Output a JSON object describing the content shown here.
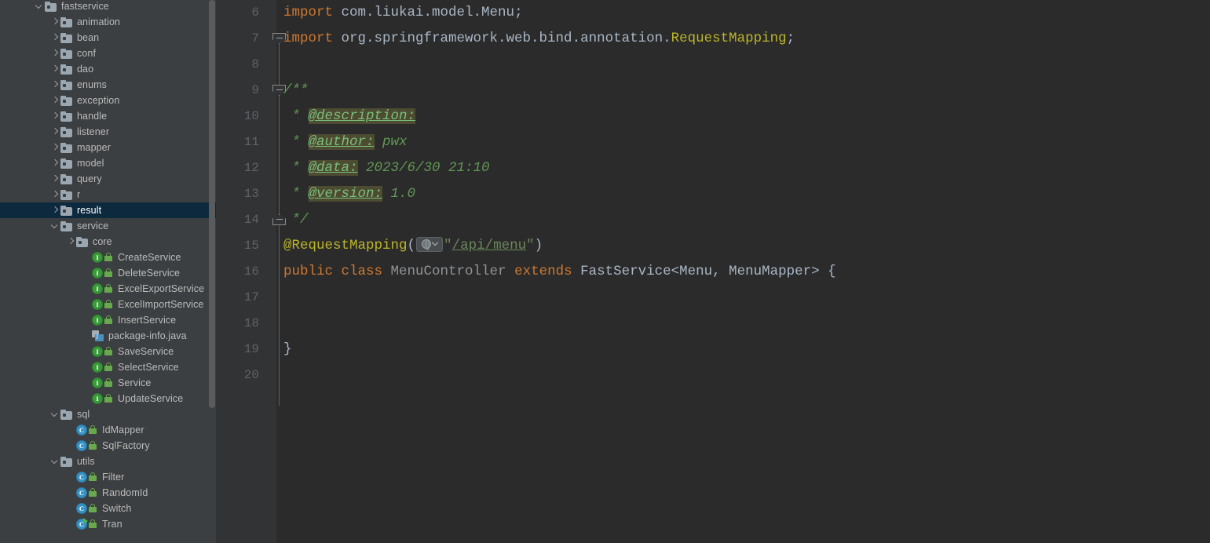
{
  "app": {
    "theme": "darcula",
    "editor_bg": "#2b2b2b",
    "sidebar_bg": "#3c3f41",
    "selection_bg": "#0d293e"
  },
  "sidebar": {
    "name": "project-tree",
    "items": [
      {
        "label": "fastservice",
        "indent": 2,
        "icon": "folder",
        "state": "expanded",
        "selected": false
      },
      {
        "label": "animation",
        "indent": 3,
        "icon": "folder",
        "state": "collapsed",
        "selected": false
      },
      {
        "label": "bean",
        "indent": 3,
        "icon": "folder",
        "state": "collapsed",
        "selected": false
      },
      {
        "label": "conf",
        "indent": 3,
        "icon": "folder",
        "state": "collapsed",
        "selected": false
      },
      {
        "label": "dao",
        "indent": 3,
        "icon": "folder",
        "state": "collapsed",
        "selected": false
      },
      {
        "label": "enums",
        "indent": 3,
        "icon": "folder",
        "state": "collapsed",
        "selected": false
      },
      {
        "label": "exception",
        "indent": 3,
        "icon": "folder",
        "state": "collapsed",
        "selected": false
      },
      {
        "label": "handle",
        "indent": 3,
        "icon": "folder",
        "state": "collapsed",
        "selected": false
      },
      {
        "label": "listener",
        "indent": 3,
        "icon": "folder",
        "state": "collapsed",
        "selected": false
      },
      {
        "label": "mapper",
        "indent": 3,
        "icon": "folder",
        "state": "collapsed",
        "selected": false
      },
      {
        "label": "model",
        "indent": 3,
        "icon": "folder",
        "state": "collapsed",
        "selected": false
      },
      {
        "label": "query",
        "indent": 3,
        "icon": "folder",
        "state": "collapsed",
        "selected": false
      },
      {
        "label": "r",
        "indent": 3,
        "icon": "folder",
        "state": "collapsed",
        "selected": false
      },
      {
        "label": "result",
        "indent": 3,
        "icon": "folder",
        "state": "collapsed",
        "selected": true
      },
      {
        "label": "service",
        "indent": 3,
        "icon": "folder",
        "state": "expanded",
        "selected": false
      },
      {
        "label": "core",
        "indent": 4,
        "icon": "folder",
        "state": "collapsed",
        "selected": false
      },
      {
        "label": "CreateService",
        "indent": 5,
        "icon": "interface",
        "state": "leaf",
        "selected": false
      },
      {
        "label": "DeleteService",
        "indent": 5,
        "icon": "interface",
        "state": "leaf",
        "selected": false
      },
      {
        "label": "ExcelExportService",
        "indent": 5,
        "icon": "interface",
        "state": "leaf",
        "selected": false
      },
      {
        "label": "ExcelImportService",
        "indent": 5,
        "icon": "interface",
        "state": "leaf",
        "selected": false
      },
      {
        "label": "InsertService",
        "indent": 5,
        "icon": "interface",
        "state": "leaf",
        "selected": false
      },
      {
        "label": "package-info.java",
        "indent": 5,
        "icon": "java-package",
        "state": "leaf",
        "selected": false
      },
      {
        "label": "SaveService",
        "indent": 5,
        "icon": "interface",
        "state": "leaf",
        "selected": false
      },
      {
        "label": "SelectService",
        "indent": 5,
        "icon": "interface",
        "state": "leaf",
        "selected": false
      },
      {
        "label": "Service",
        "indent": 5,
        "icon": "interface",
        "state": "leaf",
        "selected": false
      },
      {
        "label": "UpdateService",
        "indent": 5,
        "icon": "interface",
        "state": "leaf",
        "selected": false
      },
      {
        "label": "sql",
        "indent": 3,
        "icon": "folder",
        "state": "expanded",
        "selected": false
      },
      {
        "label": "IdMapper",
        "indent": 4,
        "icon": "class",
        "state": "leaf",
        "selected": false
      },
      {
        "label": "SqlFactory",
        "indent": 4,
        "icon": "class",
        "state": "leaf",
        "selected": false
      },
      {
        "label": "utils",
        "indent": 3,
        "icon": "folder",
        "state": "expanded",
        "selected": false
      },
      {
        "label": "Filter",
        "indent": 4,
        "icon": "class",
        "state": "leaf",
        "selected": false
      },
      {
        "label": "RandomId",
        "indent": 4,
        "icon": "class",
        "state": "leaf",
        "selected": false
      },
      {
        "label": "Switch",
        "indent": 4,
        "icon": "class",
        "state": "leaf",
        "selected": false
      },
      {
        "label": "Tran",
        "indent": 4,
        "icon": "class-run",
        "state": "leaf",
        "selected": false
      }
    ]
  },
  "editor": {
    "name": "code-editor",
    "first_line": 6,
    "lines": [
      {
        "num": "6",
        "segments": [
          {
            "t": "import ",
            "c": "kw"
          },
          {
            "t": "com.liukai.model.",
            "c": "cls"
          },
          {
            "t": "Menu",
            "c": "cls"
          },
          {
            "t": ";",
            "c": "punct"
          }
        ]
      },
      {
        "num": "7",
        "fold": "start",
        "segments": [
          {
            "t": "import ",
            "c": "kw"
          },
          {
            "t": "org.springframework.web.bind.annotation.",
            "c": "cls"
          },
          {
            "t": "RequestMapping",
            "c": "anno"
          },
          {
            "t": ";",
            "c": "punct"
          }
        ]
      },
      {
        "num": "8",
        "segments": []
      },
      {
        "num": "9",
        "fold": "doc-start",
        "segments": [
          {
            "t": "/**",
            "c": "cmt"
          }
        ]
      },
      {
        "num": "10",
        "segments": [
          {
            "t": " * ",
            "c": "cmt"
          },
          {
            "t": "@description:",
            "c": "tag"
          }
        ]
      },
      {
        "num": "11",
        "segments": [
          {
            "t": " * ",
            "c": "cmt"
          },
          {
            "t": "@author:",
            "c": "tag"
          },
          {
            "t": " pwx",
            "c": "tagval"
          }
        ]
      },
      {
        "num": "12",
        "segments": [
          {
            "t": " * ",
            "c": "cmt"
          },
          {
            "t": "@data:",
            "c": "tag"
          },
          {
            "t": " 2023/6/30 21:10",
            "c": "tagval"
          }
        ]
      },
      {
        "num": "13",
        "segments": [
          {
            "t": " * ",
            "c": "cmt"
          },
          {
            "t": "@version:",
            "c": "tag"
          },
          {
            "t": " 1.0",
            "c": "tagval"
          }
        ]
      },
      {
        "num": "14",
        "fold": "doc-end",
        "segments": [
          {
            "t": " */",
            "c": "cmt"
          }
        ]
      },
      {
        "num": "15",
        "inject": true,
        "segments": [
          {
            "t": "@RequestMapping",
            "c": "anno"
          },
          {
            "t": "(",
            "c": "punct"
          },
          {
            "t": "__INJECT__",
            "c": "badge"
          },
          {
            "t": "\"",
            "c": "str"
          },
          {
            "t": "/api/menu",
            "c": "urlstr"
          },
          {
            "t": "\"",
            "c": "str"
          },
          {
            "t": ")",
            "c": "punct"
          }
        ]
      },
      {
        "num": "16",
        "segments": [
          {
            "t": "public ",
            "c": "kw"
          },
          {
            "t": "class ",
            "c": "kw"
          },
          {
            "t": "MenuController",
            "c": "clsgray"
          },
          {
            "t": " extends ",
            "c": "kw"
          },
          {
            "t": "FastService<Menu, MenuMapper> {",
            "c": "cls"
          }
        ]
      },
      {
        "num": "17",
        "segments": []
      },
      {
        "num": "18",
        "segments": []
      },
      {
        "num": "19",
        "segments": [
          {
            "t": "}",
            "c": "punct"
          }
        ]
      },
      {
        "num": "20",
        "segments": []
      }
    ]
  }
}
